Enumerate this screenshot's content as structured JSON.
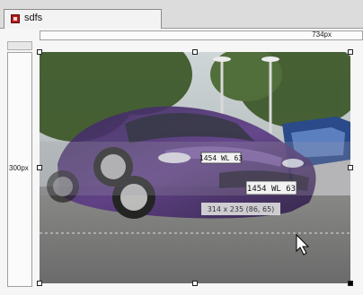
{
  "tab": {
    "label": "sdfs",
    "icon": "image-file-icon"
  },
  "ruler": {
    "width_label": "734px",
    "height_label": "300px"
  },
  "photo": {
    "plate_front": "1454 WL 63",
    "plate_back": "1454 WL 63",
    "selection_label": "314 x 235 (86, 65)"
  },
  "colors": {
    "car": "#4a2a6a",
    "tab_icon": "#b21e1e"
  }
}
